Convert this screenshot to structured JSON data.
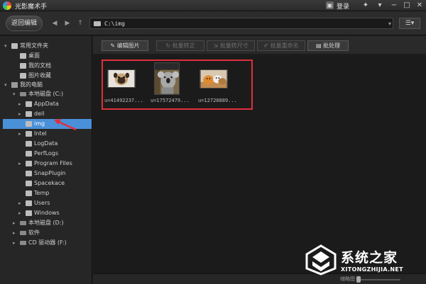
{
  "window": {
    "title": "光影魔术手",
    "login": "登录"
  },
  "toolbar": {
    "back_edit": "返回编辑",
    "address": "C:\\img"
  },
  "sidebar": {
    "items": [
      {
        "label": "常用文件夹",
        "icon": "folder-icon",
        "expanded": true
      },
      {
        "label": "桌面",
        "icon": "desktop-icon"
      },
      {
        "label": "我的文档",
        "icon": "document-icon"
      },
      {
        "label": "图片收藏",
        "icon": "picture-icon"
      },
      {
        "label": "我的电脑",
        "icon": "computer-icon",
        "expanded": true
      },
      {
        "label": "本地磁盘 (C:)",
        "icon": "drive-icon",
        "expanded": true
      },
      {
        "label": "AppData",
        "icon": "folder-icon"
      },
      {
        "label": "dell",
        "icon": "folder-icon"
      },
      {
        "label": "img",
        "icon": "folder-icon",
        "selected": true
      },
      {
        "label": "Intel",
        "icon": "folder-icon"
      },
      {
        "label": "LogData",
        "icon": "folder-icon"
      },
      {
        "label": "PerfLogs",
        "icon": "folder-icon"
      },
      {
        "label": "Program Files",
        "icon": "folder-icon"
      },
      {
        "label": "SnapPlugin",
        "icon": "folder-icon"
      },
      {
        "label": "Spacekace",
        "icon": "folder-icon"
      },
      {
        "label": "Temp",
        "icon": "folder-icon"
      },
      {
        "label": "Users",
        "icon": "folder-icon"
      },
      {
        "label": "Windows",
        "icon": "folder-icon"
      },
      {
        "label": "本地磁盘 (D:)",
        "icon": "drive-icon"
      },
      {
        "label": "软件",
        "icon": "drive-icon"
      },
      {
        "label": "CD 驱动器 (F:)",
        "icon": "cd-drive-icon"
      }
    ]
  },
  "actions": [
    {
      "label": "编辑图片",
      "icon": "pencil-icon",
      "enabled": true
    },
    {
      "label": "批量转正",
      "icon": "rotate-icon",
      "enabled": false
    },
    {
      "label": "批量转尺寸",
      "icon": "resize-icon",
      "enabled": false
    },
    {
      "label": "批量重命名",
      "icon": "rename-icon",
      "enabled": false
    },
    {
      "label": "批处理",
      "icon": "batch-icon",
      "enabled": true
    }
  ],
  "thumbnails": [
    {
      "label": "u=41492237..."
    },
    {
      "label": "u=17572479..."
    },
    {
      "label": "u=12720889..."
    }
  ],
  "status": {
    "zoom_label": "缩略图"
  },
  "watermark": {
    "name": "系统之家",
    "url": "XITONGZHIJIA.NET"
  },
  "colors": {
    "selection": "#4a90d9",
    "highlight": "#e0303a",
    "background": "#1e1e1e"
  }
}
